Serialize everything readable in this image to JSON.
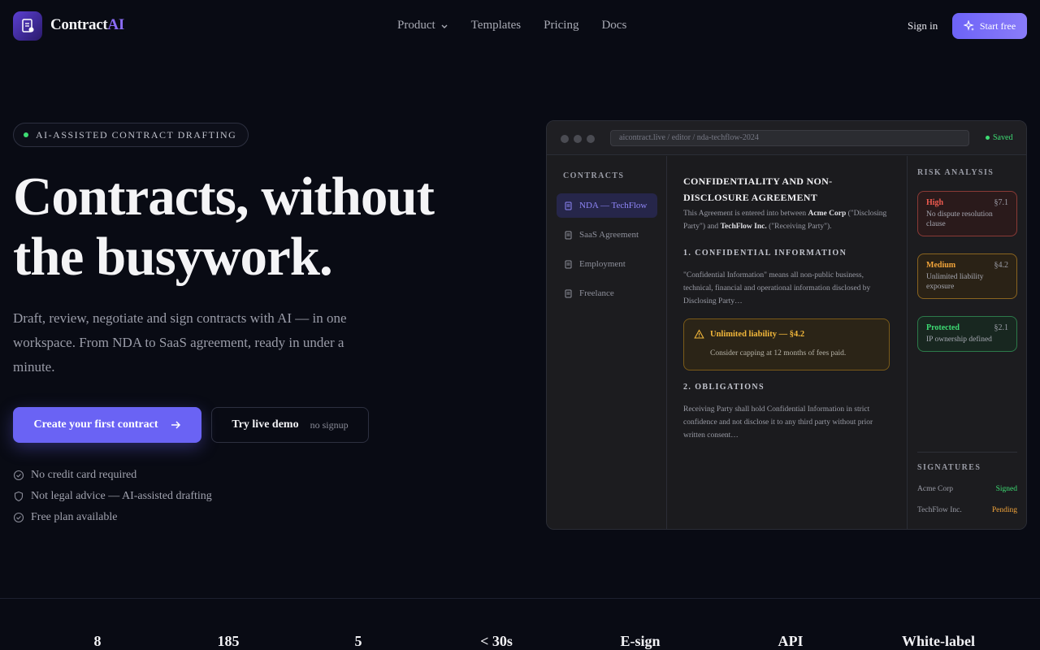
{
  "brand": {
    "name": "Contract",
    "name_accent": "AI",
    "accent_color": "#8b6cf6"
  },
  "nav": {
    "links": [
      "Product",
      "Templates",
      "Pricing",
      "Docs"
    ],
    "signin": "Sign in",
    "start": "Start free"
  },
  "hero": {
    "badge": "AI-ASSISTED CONTRACT DRAFTING",
    "headline_1": "Contracts, without",
    "headline_2": "the busywork.",
    "subtitle": "Draft, review, negotiate and sign contracts with AI — in one workspace. From NDA to SaaS agreement, ready in under a minute.",
    "cta_primary": "Create your first contract",
    "cta_secondary": "Try live demo",
    "cta_secondary_note": "no signup",
    "checks": [
      "No credit card required",
      "Not legal advice — AI-assisted drafting",
      "Free plan available"
    ]
  },
  "app": {
    "url": "aicontract.live / editor / nda-techflow-2024",
    "saved": "Saved",
    "sidebar_heading": "CONTRACTS",
    "sidebar_items": [
      "NDA — TechFlow",
      "SaaS Agreement",
      "Employment",
      "Freelance"
    ],
    "doc": {
      "title": "CONFIDENTIALITY AND NON-DISCLOSURE AGREEMENT",
      "intro_a": "This Agreement is entered into between ",
      "intro_party1": "Acme Corp",
      "intro_b": " (\"Disclosing Party\") and ",
      "intro_party2": "TechFlow Inc.",
      "intro_c": " (\"Receiving Party\").",
      "s1_heading": "1. CONFIDENTIAL INFORMATION",
      "s1_body": "\"Confidential Information\" means all non-public business, technical, financial and operational information disclosed by Disclosing Party…",
      "warn_title": "Unlimited liability — §4.2",
      "warn_body": "Consider capping at 12 months of fees paid.",
      "s2_heading": "2. OBLIGATIONS",
      "s2_body": "Receiving Party shall hold Confidential Information in strict confidence and not disclose it to any third party without prior written consent…"
    },
    "risk": {
      "heading": "RISK ANALYSIS",
      "cards": [
        {
          "level": "High",
          "section": "§7.1",
          "desc": "No dispute resolution clause"
        },
        {
          "level": "Medium",
          "section": "§4.2",
          "desc": "Unlimited liability exposure"
        },
        {
          "level": "Protected",
          "section": "§2.1",
          "desc": "IP ownership defined"
        }
      ],
      "sig_heading": "SIGNATURES",
      "signatures": [
        {
          "party": "Acme Corp",
          "status": "Signed",
          "color": "#3ddc73"
        },
        {
          "party": "TechFlow Inc.",
          "status": "Pending",
          "color": "#f2a43a"
        }
      ]
    }
  },
  "stats": [
    "8",
    "185",
    "5",
    "< 30s",
    "E-sign",
    "API",
    "White-label"
  ]
}
